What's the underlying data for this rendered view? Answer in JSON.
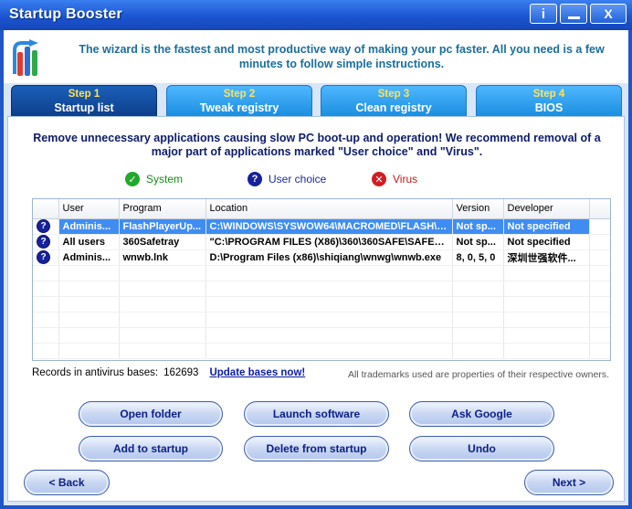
{
  "window": {
    "title": "Startup Booster",
    "info_label": "i",
    "close_label": "X"
  },
  "header": {
    "text": "The wizard is the fastest and most productive way of making your pc faster. All you need is a few minutes to follow simple instructions."
  },
  "tabs": [
    {
      "step": "Step 1",
      "label": "Startup list"
    },
    {
      "step": "Step 2",
      "label": "Tweak registry"
    },
    {
      "step": "Step 3",
      "label": "Clean registry"
    },
    {
      "step": "Step 4",
      "label": "BIOS"
    }
  ],
  "description": "Remove unnecessary applications causing slow PC boot-up and operation! We recommend removal of a major part of applications marked \"User choice\" and \"Virus\".",
  "legend": {
    "system": "System",
    "user_choice": "User choice",
    "virus": "Virus"
  },
  "table": {
    "columns": [
      "User",
      "Program",
      "Location",
      "Version",
      "Developer"
    ],
    "rows": [
      {
        "user": "Adminis...",
        "program": "FlashPlayerUp...",
        "location": "C:\\WINDOWS\\SYSWOW64\\MACROMED\\FLASH\\FLA...",
        "version": "Not sp...",
        "developer": "Not specified"
      },
      {
        "user": "All users",
        "program": "360Safetray",
        "location": "\"C:\\PROGRAM FILES (X86)\\360\\360SAFE\\SAFEMON\\...",
        "version": "Not sp...",
        "developer": "Not specified"
      },
      {
        "user": "Adminis...",
        "program": "wnwb.lnk",
        "location": "D:\\Program Files (x86)\\shiqiang\\wnwg\\wnwb.exe",
        "version": "8, 0, 5, 0",
        "developer": "深圳世强软件..."
      }
    ]
  },
  "records": {
    "label": "Records in antivirus bases:",
    "value": "162693",
    "update_link": "Update bases now!"
  },
  "trademark": "All trademarks used are properties of their respective owners.",
  "buttons": {
    "open_folder": "Open folder",
    "launch_software": "Launch software",
    "ask_google": "Ask Google",
    "add_to_startup": "Add to startup",
    "delete_from_startup": "Delete from startup",
    "undo": "Undo",
    "back": "< Back",
    "next": "Next >"
  },
  "colors": {
    "title_bar": "#1f56c8",
    "tab_active": "#0d3f8c",
    "tab_inactive": "#1a8ee0",
    "selection": "#3f8df2",
    "user_choice_icon": "#16229a",
    "system_icon": "#22a82a",
    "virus_icon": "#cf1d24"
  },
  "icons": {
    "info": "info-icon",
    "minimize": "minimize-icon",
    "close": "close-icon",
    "logo": "startup-booster-logo",
    "system": "check-circle-icon",
    "user_choice": "question-circle-icon",
    "virus": "x-circle-icon"
  }
}
